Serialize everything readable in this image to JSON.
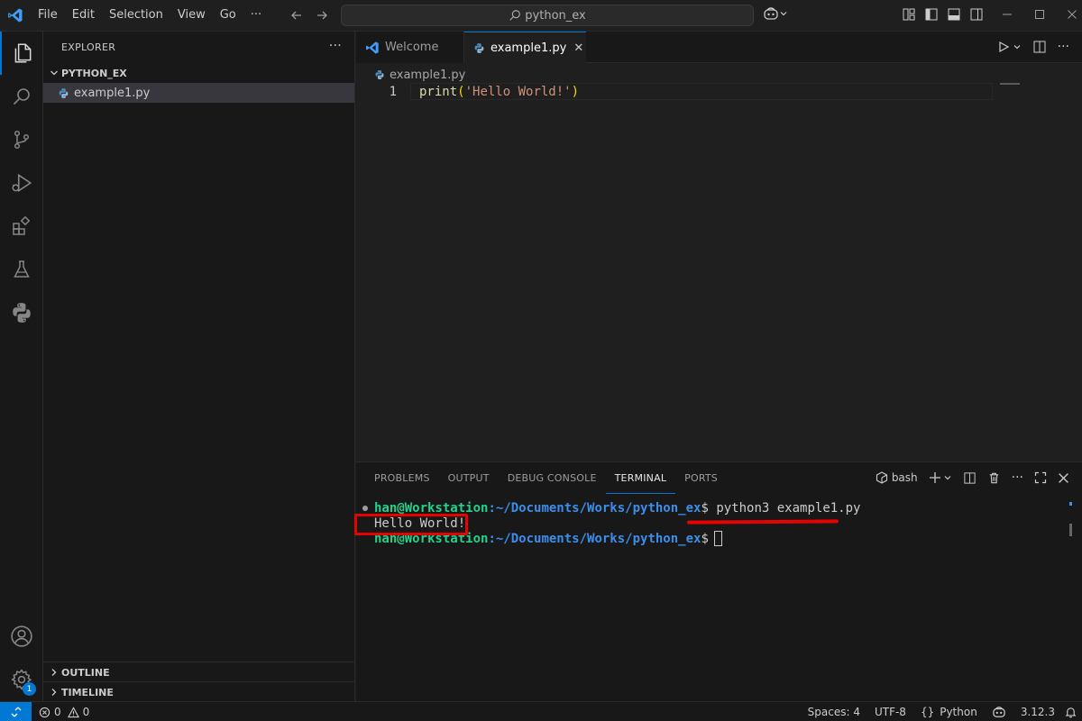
{
  "titlebar": {
    "menu": [
      "File",
      "Edit",
      "Selection",
      "View",
      "Go"
    ],
    "more_label": "···",
    "search_text": "python_ex"
  },
  "sidebar": {
    "title": "EXPLORER",
    "more_label": "···",
    "folder_name": "PYTHON_EX",
    "files": [
      "example1.py"
    ],
    "outline_label": "OUTLINE",
    "timeline_label": "TIMELINE",
    "settings_badge": "1"
  },
  "editor": {
    "tabs": [
      {
        "label": "Welcome",
        "active": false
      },
      {
        "label": "example1.py",
        "active": true
      }
    ],
    "close_glyph": "✕",
    "breadcrumb": "example1.py",
    "lines": [
      {
        "number": "1",
        "fn": "print",
        "open": "(",
        "str": "'Hello World!'",
        "close": ")"
      }
    ]
  },
  "panel": {
    "tabs": [
      "PROBLEMS",
      "OUTPUT",
      "DEBUG CONSOLE",
      "TERMINAL",
      "PORTS"
    ],
    "active_tab": "TERMINAL",
    "shell_label": "bash",
    "terminal": {
      "user": "han@Workstation",
      "path": ":~/Documents/Works/python_ex",
      "prompt_symbol": "$",
      "command": " python3 example1.py",
      "output": "Hello World!"
    }
  },
  "statusbar": {
    "errors": "0",
    "warnings": "0",
    "spaces": "Spaces: 4",
    "encoding": "UTF-8",
    "language": "Python",
    "language_prefix": "{}",
    "python_version": "3.12.3"
  },
  "colors": {
    "accent": "#0078d4",
    "annotation_red": "#e60000",
    "terminal_user": "#23d18b",
    "terminal_path": "#3b8eea"
  }
}
